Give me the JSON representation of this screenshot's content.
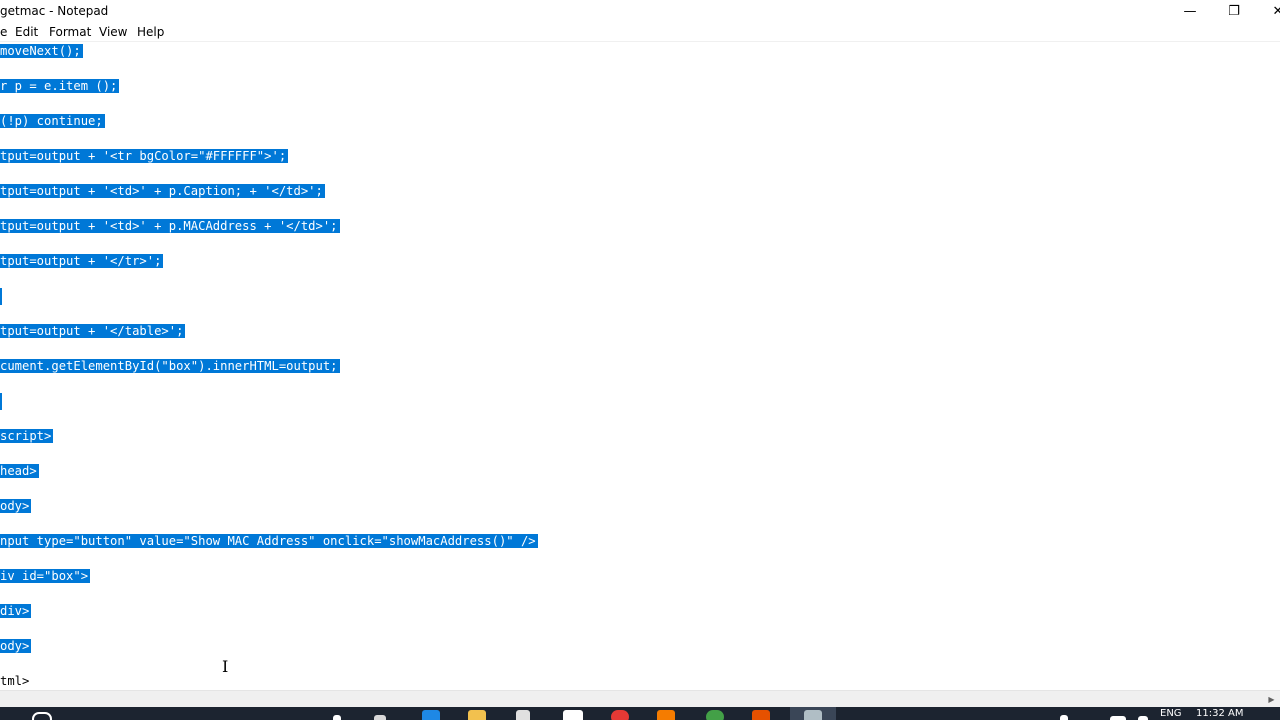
{
  "window": {
    "title": "getmac - Notepad",
    "minimize_glyph": "—",
    "maximize_glyph": "❐",
    "close_glyph": "✕"
  },
  "menu": {
    "file": "e",
    "edit": "Edit",
    "format": "Format",
    "view": "View",
    "help": "Help"
  },
  "editor": {
    "lines": [
      "moveNext();",
      "r p = e.item ();",
      "(!p) continue;",
      "tput=output + '<tr bgColor=\"#FFFFFF\">';",
      "tput=output + '<td>' + p.Caption; + '</td>';",
      "tput=output + '<td>' + p.MACAddress + '</td>';",
      "tput=output + '</tr>';",
      "tput=output + '</table>';",
      "cument.getElementById(\"box\").innerHTML=output;",
      "script>",
      "head>",
      "ody>",
      "nput type=\"button\" value=\"Show MAC Address\" onclick=\"showMacAddress()\" />",
      "iv id=\"box\">",
      "div>",
      "ody>",
      "tml>"
    ]
  },
  "taskbar": {
    "language": "ENG",
    "time": "11:32 AM"
  },
  "colors": {
    "selection": "#0078d7",
    "taskbar": "#1c2430"
  }
}
